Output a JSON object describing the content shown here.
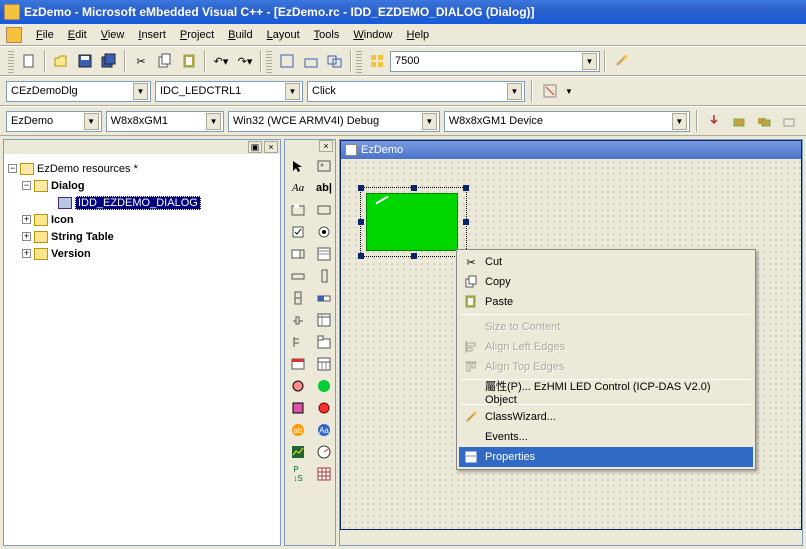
{
  "title": "EzDemo - Microsoft eMbedded Visual C++ - [EzDemo.rc - IDD_EZDEMO_DIALOG (Dialog)]",
  "menu": {
    "file": "File",
    "edit": "Edit",
    "view": "View",
    "insert": "Insert",
    "project": "Project",
    "build": "Build",
    "layout": "Layout",
    "tools": "Tools",
    "window": "Window",
    "help": "Help"
  },
  "toolbar1_combo": "7500",
  "row1": {
    "class": "CEzDemoDlg",
    "ctrl": "IDC_LEDCTRL1",
    "event": "Click"
  },
  "row2": {
    "project": "EzDemo",
    "sdk": "W8x8xGM1",
    "config": "Win32 (WCE ARMV4I) Debug",
    "device": "W8x8xGM1 Device"
  },
  "tree": {
    "root": "EzDemo resources *",
    "dialog": "Dialog",
    "dlg_id": "IDD_EZDEMO_DIALOG",
    "icon": "Icon",
    "string": "String Table",
    "version": "Version"
  },
  "dlg_caption": "EzDemo",
  "ctx": {
    "cut": "Cut",
    "copy": "Copy",
    "paste": "Paste",
    "size": "Size to Content",
    "align_left": "Align Left Edges",
    "align_top": "Align Top Edges",
    "prop_obj": "屬性(P)... EzHMI LED Control (ICP-DAS V2.0) Object",
    "classwiz": "ClassWizard...",
    "events": "Events...",
    "properties": "Properties"
  }
}
